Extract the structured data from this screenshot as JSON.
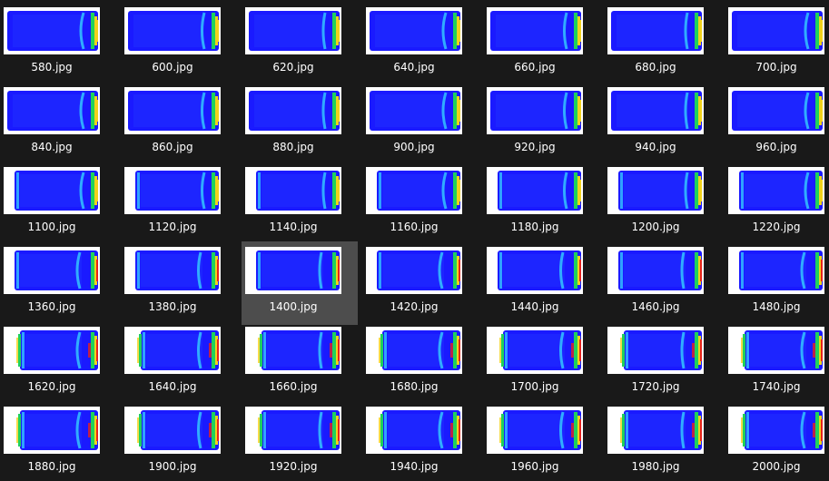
{
  "view": "large-icons",
  "selected_file": "1400.jpg",
  "colors": {
    "background": "#191919",
    "selection": "#4d4d4d",
    "label_text": "#ffffff",
    "thumb_field": "#1a1aff",
    "thumb_green": "#1fd15c",
    "thumb_cyan": "#34c6ff",
    "thumb_red": "#e6231c",
    "thumb_yellow": "#f2d21a"
  },
  "files": [
    [
      "580.jpg",
      "600.jpg",
      "620.jpg",
      "640.jpg",
      "660.jpg",
      "680.jpg",
      "700.jpg"
    ],
    [
      "840.jpg",
      "860.jpg",
      "880.jpg",
      "900.jpg",
      "920.jpg",
      "940.jpg",
      "960.jpg"
    ],
    [
      "1100.jpg",
      "1120.jpg",
      "1140.jpg",
      "1160.jpg",
      "1180.jpg",
      "1200.jpg",
      "1220.jpg"
    ],
    [
      "1360.jpg",
      "1380.jpg",
      "1400.jpg",
      "1420.jpg",
      "1440.jpg",
      "1460.jpg",
      "1480.jpg"
    ],
    [
      "1620.jpg",
      "1640.jpg",
      "1660.jpg",
      "1680.jpg",
      "1700.jpg",
      "1720.jpg",
      "1740.jpg"
    ],
    [
      "1880.jpg",
      "1900.jpg",
      "1920.jpg",
      "1940.jpg",
      "1960.jpg",
      "1980.jpg",
      "2000.jpg"
    ]
  ]
}
